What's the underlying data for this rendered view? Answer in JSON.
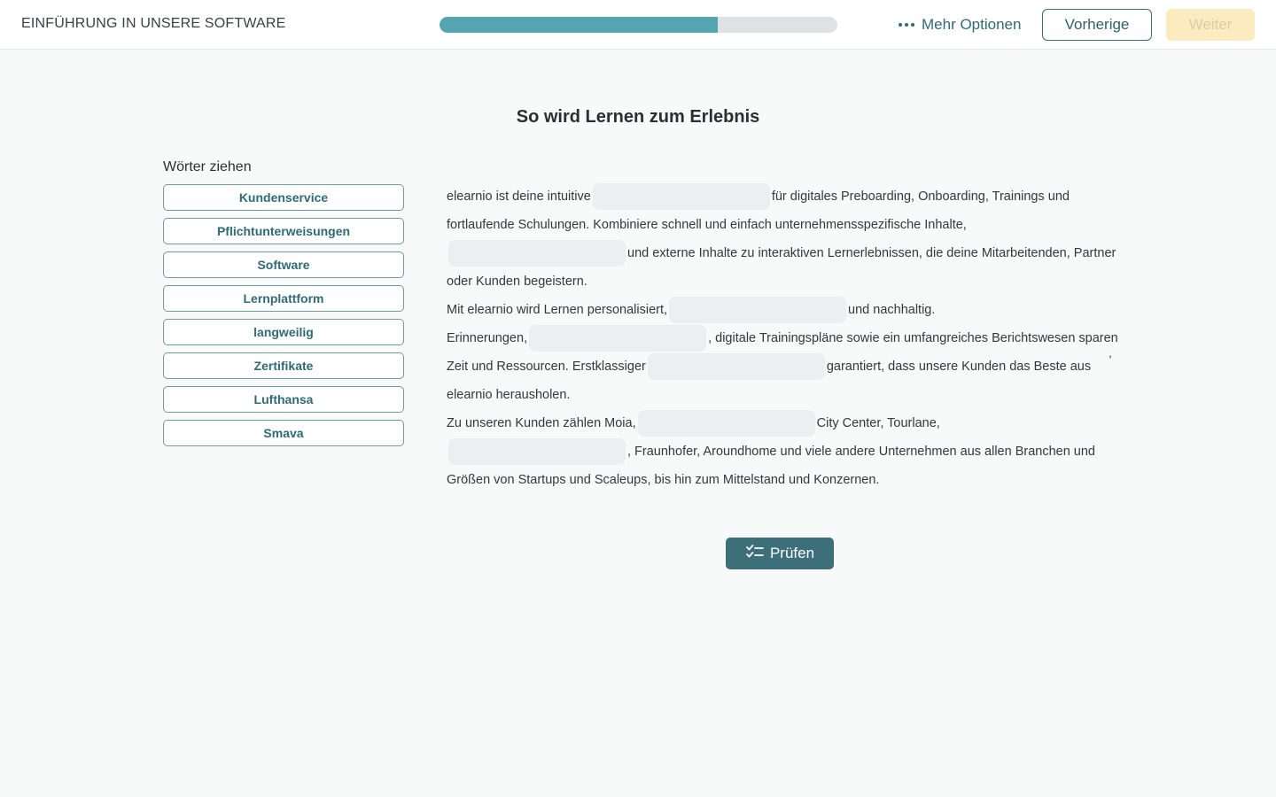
{
  "header": {
    "course_title": "EINFÜHRUNG IN UNSERE SOFTWARE",
    "progress": 0.7,
    "more_options_label": "Mehr Optionen",
    "more_options_icon": "more-dots-icon",
    "prev_label": "Vorherige",
    "next_label": "Weiter"
  },
  "main": {
    "title": "So wird Lernen zum Erlebnis",
    "words_heading": "Wörter ziehen",
    "words": [
      "Kundenservice",
      "Pflichtunterweisungen",
      "Software",
      "Lernplattform",
      "langweilig",
      "Zertifikate",
      "Lufthansa",
      "Smava"
    ],
    "text_segments": [
      "elearnio ist deine intuitive",
      "für digitales Preboarding, Onboarding, Trainings und fortlaufende Schulungen. Kombiniere schnell und einfach unternehmensspezifische Inhalte,",
      "und externe Inhalte zu interaktiven Lernerlebnissen, die deine Mitarbeitenden, Partner oder Kunden begeistern.",
      "Mit elearnio wird Lernen personalisiert,",
      "und nachhaltig.",
      "Erinnerungen,",
      ", digitale Trainingspläne sowie ein umfangreiches Berichtswesen sparen Zeit und Ressourcen. Erstklassiger",
      "garantiert, dass unsere Kunden das Beste aus elearnio herausholen.",
      "Zu unseren Kunden zählen Moia,",
      "City Center, Tourlane,",
      ", Fraunhofer, Aroundhome und viele andere Unternehmen aus allen Branchen und Größen von Startups und Scaleups, bis hin zum Mittelstand und Konzernen."
    ],
    "stray_comma": ",",
    "check_label": "Prüfen",
    "check_icon": "checklist-icon"
  },
  "colors": {
    "accent": "#3d6f7a",
    "progress_fill": "#55a5b1",
    "next_disabled": "#fcebbf"
  }
}
